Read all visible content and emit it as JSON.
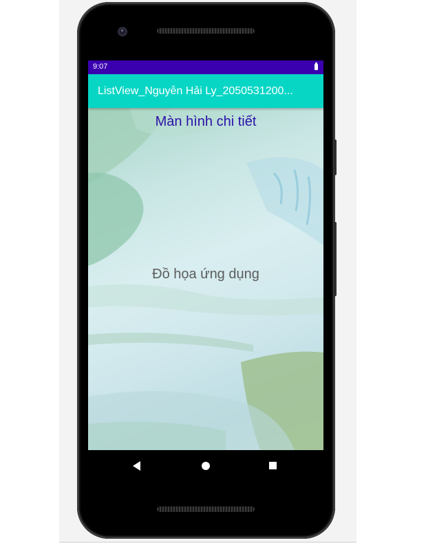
{
  "status_bar": {
    "time": "9:07"
  },
  "app_bar": {
    "title": "ListView_Nguyễn Hải Ly_2050531200..."
  },
  "detail": {
    "heading": "Màn hình chi tiết",
    "item_name": "Đồ họa ứng dụng"
  },
  "colors": {
    "status_bar": "#3a00b0",
    "app_bar": "#07d6c5",
    "heading_text": "#2a10a8",
    "item_text": "#5c5c5c"
  },
  "icons": {
    "battery": "battery-icon",
    "nav_back": "back-triangle-icon",
    "nav_home": "home-circle-icon",
    "nav_recents": "recents-square-icon"
  }
}
